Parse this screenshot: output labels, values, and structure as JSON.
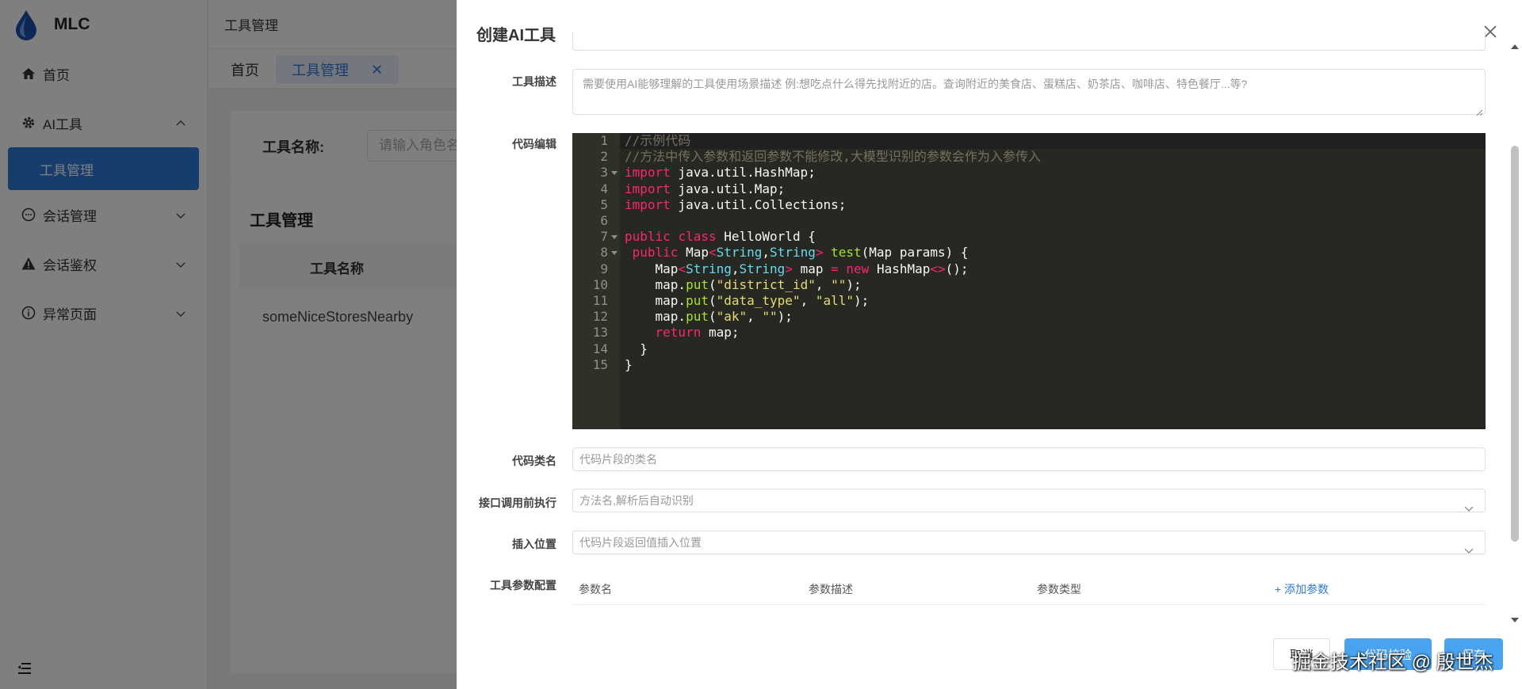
{
  "sidebar": {
    "brand": "MLC",
    "items": [
      {
        "label": "首页"
      },
      {
        "label": "AI工具"
      },
      {
        "label": "工具管理"
      },
      {
        "label": "会话管理"
      },
      {
        "label": "会话鉴权"
      },
      {
        "label": "异常页面"
      }
    ]
  },
  "header": {
    "title": "工具管理",
    "tabs": [
      {
        "label": "首页"
      },
      {
        "label": "工具管理"
      }
    ]
  },
  "main": {
    "search_label": "工具名称:",
    "search_placeholder": "请输入角色名称",
    "table_title": "工具管理",
    "column_tool_name": "工具名称",
    "rows": [
      {
        "name": "someNiceStoresNearby"
      }
    ]
  },
  "drawer": {
    "title": "创建AI工具",
    "fields": {
      "description_label": "工具描述",
      "description_placeholder": "需要使用AI能够理解的工具使用场景描述 例:想吃点什么得先找附近的店。查询附近的美食店、蛋糕店、奶茶店、咖啡店、特色餐厅...等?",
      "code_label": "代码编辑",
      "class_label": "代码类名",
      "class_placeholder": "代码片段的类名",
      "before_label": "接口调用前执行",
      "before_placeholder": "方法名,解析后自动识别",
      "insert_label": "插入位置",
      "insert_placeholder": "代码片段返回值插入位置",
      "params_label": "工具参数配置"
    },
    "params_table": {
      "col_name": "参数名",
      "col_desc": "参数描述",
      "col_type": "参数类型",
      "add_label": "+ 添加参数"
    },
    "code_lines": [
      "//示例代码",
      "//方法中传入参数和返回参数不能修改,大模型识别的参数会作为入参传入",
      "import java.util.HashMap;",
      "import java.util.Map;",
      "import java.util.Collections;",
      "",
      "public class HelloWorld {",
      " public Map<String,String> test(Map params) {",
      "    Map<String,String> map = new HashMap<>();",
      "    map.put(\"district_id\", \"\");",
      "    map.put(\"data_type\", \"all\");",
      "    map.put(\"ak\", \"\");",
      "    return map;",
      "  }",
      "}"
    ],
    "buttons": {
      "cancel": "取消",
      "verify": "代码校验",
      "save": "保存"
    }
  },
  "watermark": "掘金技术社区 @ 殷世杰",
  "colors": {
    "primary": "#2f7bd8",
    "button": "#4aa3ee",
    "editor_bg": "#272822"
  }
}
